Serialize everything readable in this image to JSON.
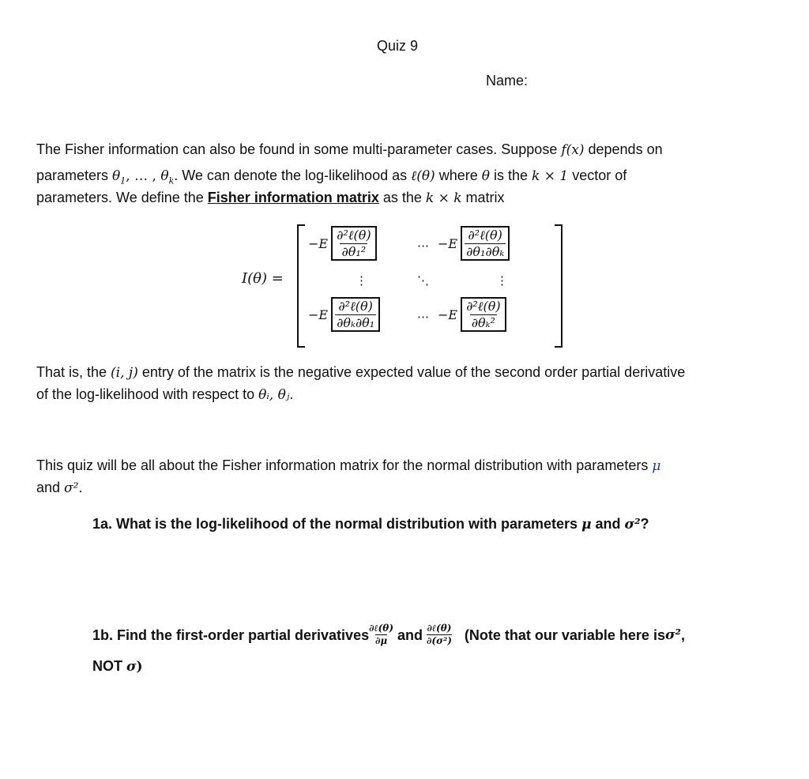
{
  "header": {
    "title": "Quiz 9",
    "name_label": "Name:"
  },
  "intro": {
    "line1_a": "The Fisher information can also be found in some multi-parameter cases. Suppose ",
    "line1_math": "f(x)",
    "line1_b": " depends on",
    "line2_a": "parameters ",
    "line2_math1": "θ",
    "line2_sub1": "1",
    "line2_mid": ", … , ",
    "line2_math2": "θ",
    "line2_sub2": "k",
    "line2_b": ". We can denote the log-likelihood as ",
    "line2_math3": "ℓ(θ)",
    "line2_c": " where ",
    "line2_math4": "θ",
    "line2_d": " is the ",
    "line2_math5": "k × 1",
    "line2_e": " vector of",
    "line3_a": "parameters. We define the ",
    "line3_term": "Fisher information matrix",
    "line3_b": " as the ",
    "line3_math": "k × k",
    "line3_c": " matrix"
  },
  "matrix": {
    "lhs": "I(θ) =",
    "neg_e": "−E",
    "e11_num": "∂²ℓ(θ)",
    "e11_den": "∂θ₁²",
    "e1k_num": "∂²ℓ(θ)",
    "e1k_den": "∂θ₁∂θₖ",
    "ek1_num": "∂²ℓ(θ)",
    "ek1_den": "∂θₖ∂θ₁",
    "ekk_num": "∂²ℓ(θ)",
    "ekk_den": "∂θₖ²",
    "hdots": "⋯",
    "vdots": "⋮",
    "ddots": "⋱"
  },
  "explanation": {
    "line1_a": "That is, the ",
    "line1_math": "(i, j)",
    "line1_b": " entry of the matrix is the negative expected value of the second order partial derivative",
    "line2_a": "of the log-likelihood with respect to ",
    "line2_math": "θᵢ, θⱼ",
    "line2_b": "."
  },
  "scope": {
    "line1_a": "This quiz will be all about the Fisher information matrix for the normal distribution with parameters ",
    "line1_math": "μ",
    "line2_a": "and ",
    "line2_math": "σ²",
    "line2_b": "."
  },
  "questions": [
    {
      "label": "1a. What is the log-likelihood of the normal distribution with parameters ",
      "math1": "μ",
      "mid": " and ",
      "math2": "σ²",
      "end": "?"
    },
    {
      "label": "1b. Find the first-order partial derivatives ",
      "frac1_num": "∂ℓ(θ)",
      "frac1_den": "∂μ",
      "mid": " and ",
      "frac2_num": "∂ℓ(θ)",
      "frac2_den": "∂(σ²)",
      "note": "(Note that our variable here is ",
      "note_math": "σ²",
      "note_end": ",",
      "line2_a": "NOT ",
      "line2_math": "σ",
      "line2_b": ")"
    }
  ]
}
